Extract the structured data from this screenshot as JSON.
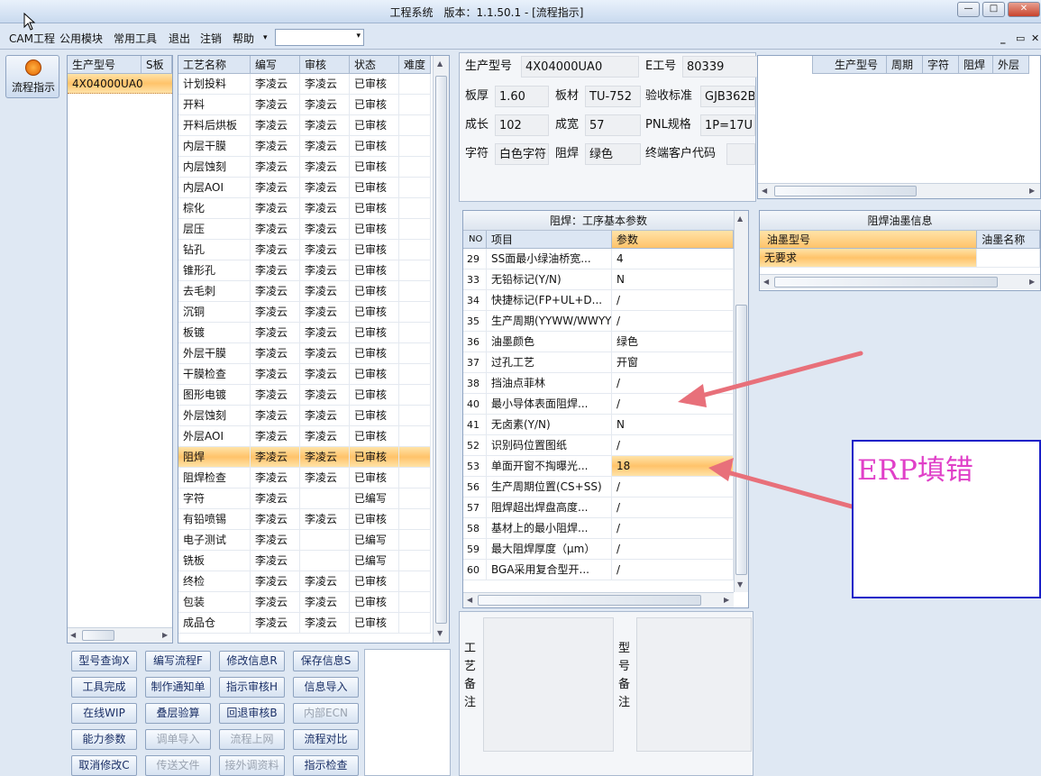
{
  "window": {
    "title": "工程系统　版本：1.1.50.1 - [流程指示]",
    "min": "—",
    "max": "□",
    "close": "✕"
  },
  "menu": {
    "items": [
      "CAM工程",
      "公用模块",
      "常用工具",
      "退出",
      "注销",
      "帮助"
    ],
    "dropdown_arrow": "▾",
    "mdi": [
      "_",
      "▭",
      "✕"
    ]
  },
  "sidebar": {
    "button_label": "流程指示",
    "icon": "flow-icon"
  },
  "model_list": {
    "headers": [
      "生产型号",
      "S板"
    ],
    "rows": [
      [
        "4X04000UA0",
        ""
      ]
    ]
  },
  "process": {
    "headers": [
      "工艺名称",
      "编写",
      "审核",
      "状态",
      "难度"
    ],
    "rows": [
      [
        "计划投料",
        "李凌云",
        "李凌云",
        "已审核"
      ],
      [
        "开料",
        "李凌云",
        "李凌云",
        "已审核"
      ],
      [
        "开料后烘板",
        "李凌云",
        "李凌云",
        "已审核"
      ],
      [
        "内层干膜",
        "李凌云",
        "李凌云",
        "已审核"
      ],
      [
        "内层蚀刻",
        "李凌云",
        "李凌云",
        "已审核"
      ],
      [
        "内层AOI",
        "李凌云",
        "李凌云",
        "已审核"
      ],
      [
        "棕化",
        "李凌云",
        "李凌云",
        "已审核"
      ],
      [
        "层压",
        "李凌云",
        "李凌云",
        "已审核"
      ],
      [
        "钻孔",
        "李凌云",
        "李凌云",
        "已审核"
      ],
      [
        "锥形孔",
        "李凌云",
        "李凌云",
        "已审核"
      ],
      [
        "去毛刺",
        "李凌云",
        "李凌云",
        "已审核"
      ],
      [
        "沉铜",
        "李凌云",
        "李凌云",
        "已审核"
      ],
      [
        "板镀",
        "李凌云",
        "李凌云",
        "已审核"
      ],
      [
        "外层干膜",
        "李凌云",
        "李凌云",
        "已审核"
      ],
      [
        "干膜检查",
        "李凌云",
        "李凌云",
        "已审核"
      ],
      [
        "图形电镀",
        "李凌云",
        "李凌云",
        "已审核"
      ],
      [
        "外层蚀刻",
        "李凌云",
        "李凌云",
        "已审核"
      ],
      [
        "外层AOI",
        "李凌云",
        "李凌云",
        "已审核"
      ],
      [
        "阻焊",
        "李凌云",
        "李凌云",
        "已审核"
      ],
      [
        "阻焊检查",
        "李凌云",
        "李凌云",
        "已审核"
      ],
      [
        "字符",
        "李凌云",
        "",
        "已编写"
      ],
      [
        "有铅喷锡",
        "李凌云",
        "李凌云",
        "已审核"
      ],
      [
        "电子测试",
        "李凌云",
        "",
        "已编写"
      ],
      [
        "铣板",
        "李凌云",
        "",
        "已编写"
      ],
      [
        "终检",
        "李凌云",
        "李凌云",
        "已审核"
      ],
      [
        "包装",
        "李凌云",
        "李凌云",
        "已审核"
      ],
      [
        "成品仓",
        "李凌云",
        "李凌云",
        "已审核"
      ]
    ],
    "selected_index": 18
  },
  "buttons": [
    [
      "型号查询X",
      "编写流程F",
      "修改信息R",
      "保存信息S"
    ],
    [
      "工具完成",
      "制作通知单",
      "指示审核H",
      "信息导入"
    ],
    [
      "在线WIP",
      "叠层验算",
      "回退审核B",
      "内部ECN"
    ],
    [
      "能力参数",
      "调单导入",
      "流程上网",
      "流程对比"
    ],
    [
      "取消修改C",
      "传送文件",
      "接外调资料",
      "指示检查"
    ]
  ],
  "disabled_buttons": [
    "内部ECN",
    "调单导入",
    "流程上网",
    "传送文件",
    "接外调资料"
  ],
  "info": {
    "prod_model_label": "生产型号",
    "prod_model": "4X04000UA0",
    "e_no_label": "E工号",
    "e_no": "80339",
    "thickness_label": "板厚",
    "thickness": "1.60",
    "material_label": "板材",
    "material": "TU-752",
    "standard_label": "验收标准",
    "standard": "GJB362B",
    "length_label": "成长",
    "length": "102",
    "width_label": "成宽",
    "width": "57",
    "pnl_label": "PNL规格",
    "pnl": "1P=17U",
    "char_label": "字符",
    "char": "白色字符",
    "mask_label": "阻焊",
    "mask": "绿色",
    "customer_label": "终端客户代码",
    "customer": ""
  },
  "right_top_headers": [
    "生产型号",
    "周期",
    "字符",
    "阻焊",
    "外层"
  ],
  "params": {
    "title": "阻焊：工序基本参数",
    "headers": [
      "NO",
      "项目",
      "参数"
    ],
    "rows": [
      [
        "29",
        "SS面最小绿油桥宽...",
        "4"
      ],
      [
        "33",
        "无铅标记(Y/N)",
        "N"
      ],
      [
        "34",
        "快捷标记(FP+UL+D...",
        "/"
      ],
      [
        "35",
        "生产周期(YYWW/WWYY)",
        "/"
      ],
      [
        "36",
        "油墨颜色",
        "绿色"
      ],
      [
        "37",
        "过孔工艺",
        "开窗"
      ],
      [
        "38",
        "挡油点菲林",
        "/"
      ],
      [
        "40",
        "最小导体表面阻焊...",
        "/"
      ],
      [
        "41",
        "无卤素(Y/N)",
        "N"
      ],
      [
        "52",
        "识别码位置图纸",
        "/"
      ],
      [
        "53",
        "单面开窗不掏曝光...",
        "18"
      ],
      [
        "56",
        "生产周期位置(CS+SS)",
        "/"
      ],
      [
        "57",
        "阻焊超出焊盘高度...",
        "/"
      ],
      [
        "58",
        "基材上的最小阻焊...",
        "/"
      ],
      [
        "59",
        "最大阻焊厚度（μm）",
        "/"
      ],
      [
        "60",
        "BGA采用复合型开...",
        "/"
      ]
    ],
    "selected_index": 10
  },
  "ink": {
    "title": "阻焊油墨信息",
    "headers": [
      "油墨型号",
      "油墨名称"
    ],
    "rows": [
      [
        "无要求",
        ""
      ]
    ]
  },
  "notes": {
    "craft_label": "工艺备注",
    "model_label": "型号备注"
  },
  "annotation": {
    "text": "ERP填错",
    "color": "#e040c8",
    "arrow_color": "#e8707a"
  }
}
